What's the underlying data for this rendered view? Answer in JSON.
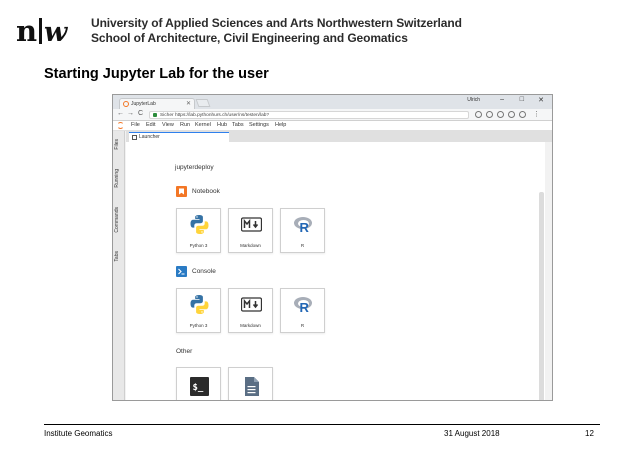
{
  "slide": {
    "institution_line1": "University of Applied Sciences and Arts Northwestern Switzerland",
    "institution_line2": "School of Architecture, Civil Engineering and Geomatics",
    "title": "Starting Jupyter Lab for the user",
    "logo_icon": "fhnw-logo",
    "footer": {
      "left": "Institute Geomatics",
      "date": "31 August 2018",
      "page": "12"
    }
  },
  "browser": {
    "tab_title": "JupyterLab",
    "user": "Ulrich",
    "window_controls": [
      "–",
      "□",
      "✕"
    ],
    "url_security": "Sicher",
    "url": "https://lab.pythonhurs.ch/user/ns/testen/lab?",
    "nav_icons": [
      "back-icon",
      "forward-icon",
      "reload-icon"
    ]
  },
  "jupyterlab": {
    "menu": [
      "File",
      "Edit",
      "View",
      "Run",
      "Kernel",
      "Hub",
      "Tabs",
      "Settings",
      "Help"
    ],
    "sidebar_tabs": [
      "Files",
      "Running",
      "Commands",
      "Tabs"
    ],
    "active_tab": "Launcher",
    "cwd": "jupyterdeploy",
    "sections": {
      "notebook": {
        "title": "Notebook",
        "items": [
          {
            "label": "Python 3",
            "icon": "python-icon"
          },
          {
            "label": "Markdown",
            "icon": "markdown-icon"
          },
          {
            "label": "R",
            "icon": "r-icon"
          }
        ]
      },
      "console": {
        "title": "Console",
        "items": [
          {
            "label": "Python 3",
            "icon": "python-icon"
          },
          {
            "label": "Markdown",
            "icon": "markdown-icon"
          },
          {
            "label": "R",
            "icon": "r-icon"
          }
        ]
      },
      "other": {
        "title": "Other",
        "items": [
          {
            "label": "",
            "icon": "terminal-icon"
          },
          {
            "label": "",
            "icon": "text-file-icon"
          }
        ]
      }
    },
    "colors": {
      "accent": "#f37726",
      "console": "#2a7bc4",
      "python_blue": "#3572a5",
      "python_yellow": "#ffd43b"
    }
  }
}
